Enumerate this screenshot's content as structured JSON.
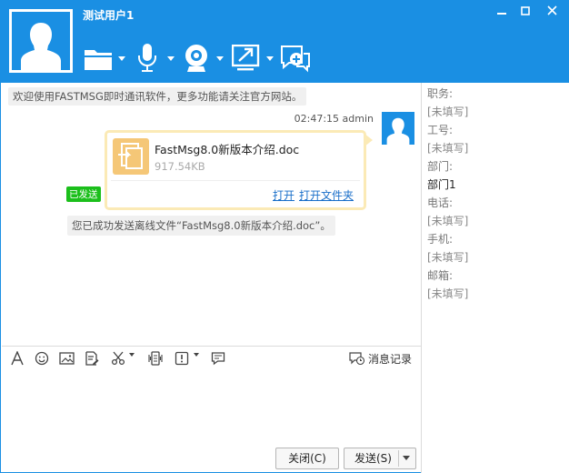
{
  "window": {
    "title": "测试用户1",
    "accent_color": "#1a8fe3"
  },
  "toolbar": {
    "icons": [
      "folder-icon",
      "microphone-icon",
      "webcam-icon",
      "share-screen-icon",
      "group-chat-icon"
    ]
  },
  "chat": {
    "notice": "欢迎使用FASTMSG即时通讯软件，更多功能请关注官方网站。",
    "message_time": "02:47:15 admin",
    "file": {
      "name": "FastMsg8.0新版本介绍.doc",
      "size": "917.54KB",
      "open_label": "打开",
      "open_folder_label": "打开文件夹"
    },
    "sent_badge": "已发送",
    "sent_notice": "您已成功发送离线文件“FastMsg8.0新版本介绍.doc”。"
  },
  "info": {
    "position_label": "职务:",
    "position_value": "[未填写]",
    "job_no_label": "工号:",
    "job_no_value": "[未填写]",
    "department_label": "部门:",
    "department_value": "部门1",
    "phone_label": "电话:",
    "phone_value": "[未填写]",
    "mobile_label": "手机:",
    "mobile_value": "[未填写]",
    "email_label": "邮箱:",
    "email_value": "[未填写]"
  },
  "input_toolbar": {
    "history_label": "消息记录"
  },
  "buttons": {
    "close_label": "关闭(C)",
    "send_label": "发送(S)"
  }
}
